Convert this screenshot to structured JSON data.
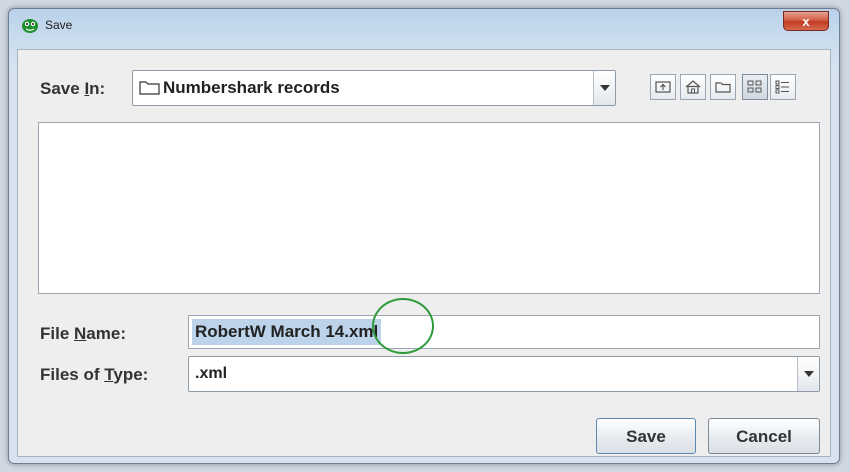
{
  "window": {
    "title": "Save",
    "close_label": "x"
  },
  "save_in": {
    "label_prefix": "Save ",
    "label_mnemonic": "I",
    "label_suffix": "n:",
    "value": "Numbershark records"
  },
  "toolbar": {
    "icons": [
      "up-one-level-icon",
      "home-icon",
      "new-folder-icon",
      "list-view-icon",
      "details-view-icon"
    ]
  },
  "file_name": {
    "label_prefix": "File ",
    "label_mnemonic": "N",
    "label_suffix": "ame:",
    "value": "RobertW March 14.xml"
  },
  "file_type": {
    "label_prefix": "Files of ",
    "label_mnemonic": "T",
    "label_suffix": "ype:",
    "value": ".xml"
  },
  "buttons": {
    "save": "Save",
    "cancel": "Cancel"
  },
  "colors": {
    "selection": "#bcd3ea",
    "highlight_circle": "#2f9a3b",
    "close_button": "#c23a22"
  }
}
